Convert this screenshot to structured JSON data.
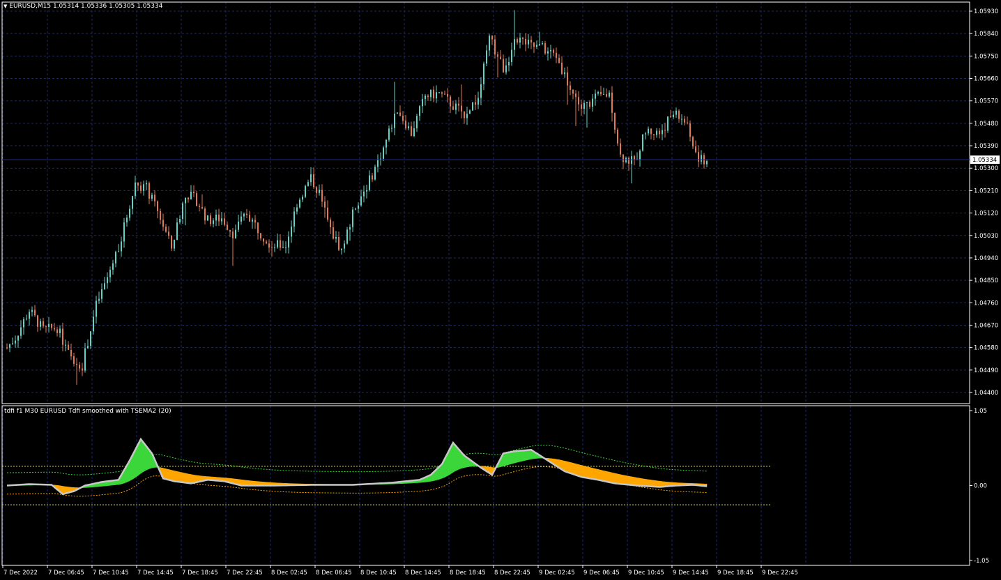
{
  "main_chart": {
    "header": "EURUSD,M15  1.05314 1.05336 1.05305 1.05334",
    "current_price": "1.05334",
    "current_price_value": 1.05334,
    "price_range": [
      1.044,
      1.0593
    ],
    "price_ticks": [
      "1.05930",
      "1.05840",
      "1.05750",
      "1.05660",
      "1.05570",
      "1.05480",
      "1.05390",
      "1.05300",
      "1.05210",
      "1.05120",
      "1.05030",
      "1.04940",
      "1.04850",
      "1.04760",
      "1.04670",
      "1.04580",
      "1.04490",
      "1.04400"
    ],
    "bull_color": "#5fd3c5",
    "bear_color": "#e07a55",
    "grid_color": "#1c2a6b",
    "price_line_color": "#1e2fa8"
  },
  "indicator": {
    "title": "tdfi f1 M30 EURUSD Tdfi smoothed with TSEMA2 (20)",
    "ticks": [
      "1.05",
      "0.00",
      "-1.05"
    ],
    "range": [
      -1.05,
      1.05
    ],
    "upper_level": 0.27,
    "lower_level": -0.27,
    "up_color": "#3ad63a",
    "down_color": "#ffa500",
    "line_color": "#c8c8c8"
  },
  "time_axis": [
    "7 Dec 2022",
    "7 Dec 06:45",
    "7 Dec 10:45",
    "7 Dec 14:45",
    "7 Dec 18:45",
    "7 Dec 22:45",
    "8 Dec 02:45",
    "8 Dec 06:45",
    "8 Dec 10:45",
    "8 Dec 14:45",
    "8 Dec 18:45",
    "8 Dec 22:45",
    "9 Dec 02:45",
    "9 Dec 06:45",
    "9 Dec 10:45",
    "9 Dec 14:45",
    "9 Dec 18:45",
    "9 Dec 22:45"
  ],
  "chart_data": {
    "type": "candlestick",
    "price_path": [
      [
        0,
        1.0458
      ],
      [
        3,
        1.0462
      ],
      [
        8,
        1.0473
      ],
      [
        13,
        1.0465
      ],
      [
        18,
        1.0466
      ],
      [
        23,
        1.0453
      ],
      [
        27,
        1.0451
      ],
      [
        32,
        1.0475
      ],
      [
        36,
        1.0486
      ],
      [
        41,
        1.0502
      ],
      [
        46,
        1.0524
      ],
      [
        50,
        1.0522
      ],
      [
        55,
        1.051
      ],
      [
        59,
        1.0498
      ],
      [
        64,
        1.052
      ],
      [
        68,
        1.0517
      ],
      [
        72,
        1.0509
      ],
      [
        77,
        1.051
      ],
      [
        81,
        1.0504
      ],
      [
        86,
        1.0512
      ],
      [
        91,
        1.0504
      ],
      [
        95,
        1.0499
      ],
      [
        100,
        1.0499
      ],
      [
        104,
        1.0516
      ],
      [
        109,
        1.0526
      ],
      [
        112,
        1.052
      ],
      [
        116,
        1.0505
      ],
      [
        120,
        1.0497
      ],
      [
        125,
        1.0515
      ],
      [
        130,
        1.0525
      ],
      [
        135,
        1.0538
      ],
      [
        140,
        1.0554
      ],
      [
        145,
        1.0544
      ],
      [
        150,
        1.0559
      ],
      [
        155,
        1.056
      ],
      [
        160,
        1.0555
      ],
      [
        164,
        1.0552
      ],
      [
        169,
        1.0558
      ],
      [
        173,
        1.0582
      ],
      [
        178,
        1.057
      ],
      [
        183,
        1.0582
      ],
      [
        188,
        1.0579
      ],
      [
        192,
        1.0578
      ],
      [
        197,
        1.0575
      ],
      [
        202,
        1.0562
      ],
      [
        206,
        1.0554
      ],
      [
        211,
        1.0558
      ],
      [
        216,
        1.056
      ],
      [
        220,
        1.0535
      ],
      [
        225,
        1.0532
      ],
      [
        229,
        1.0545
      ],
      [
        234,
        1.0544
      ],
      [
        239,
        1.0552
      ],
      [
        243,
        1.0549
      ],
      [
        248,
        1.0533
      ],
      [
        251,
        1.05334
      ]
    ],
    "tdfi_path": [
      [
        0,
        0.0
      ],
      [
        8,
        0.02
      ],
      [
        16,
        0.01
      ],
      [
        20,
        -0.12
      ],
      [
        24,
        -0.08
      ],
      [
        28,
        0.0
      ],
      [
        34,
        0.05
      ],
      [
        40,
        0.08
      ],
      [
        44,
        0.35
      ],
      [
        48,
        0.65
      ],
      [
        52,
        0.45
      ],
      [
        56,
        0.1
      ],
      [
        60,
        0.06
      ],
      [
        66,
        0.03
      ],
      [
        72,
        0.08
      ],
      [
        78,
        0.06
      ],
      [
        84,
        0.0
      ],
      [
        96,
        0.0
      ],
      [
        110,
        0.01
      ],
      [
        124,
        0.01
      ],
      [
        138,
        0.04
      ],
      [
        148,
        0.08
      ],
      [
        152,
        0.15
      ],
      [
        156,
        0.3
      ],
      [
        160,
        0.6
      ],
      [
        164,
        0.42
      ],
      [
        170,
        0.25
      ],
      [
        174,
        0.15
      ],
      [
        178,
        0.45
      ],
      [
        182,
        0.48
      ],
      [
        188,
        0.5
      ],
      [
        194,
        0.35
      ],
      [
        200,
        0.2
      ],
      [
        206,
        0.12
      ],
      [
        212,
        0.08
      ],
      [
        218,
        0.03
      ],
      [
        226,
        0.0
      ],
      [
        234,
        -0.02
      ],
      [
        240,
        0.0
      ],
      [
        246,
        0.01
      ],
      [
        251,
        -0.01
      ]
    ]
  }
}
